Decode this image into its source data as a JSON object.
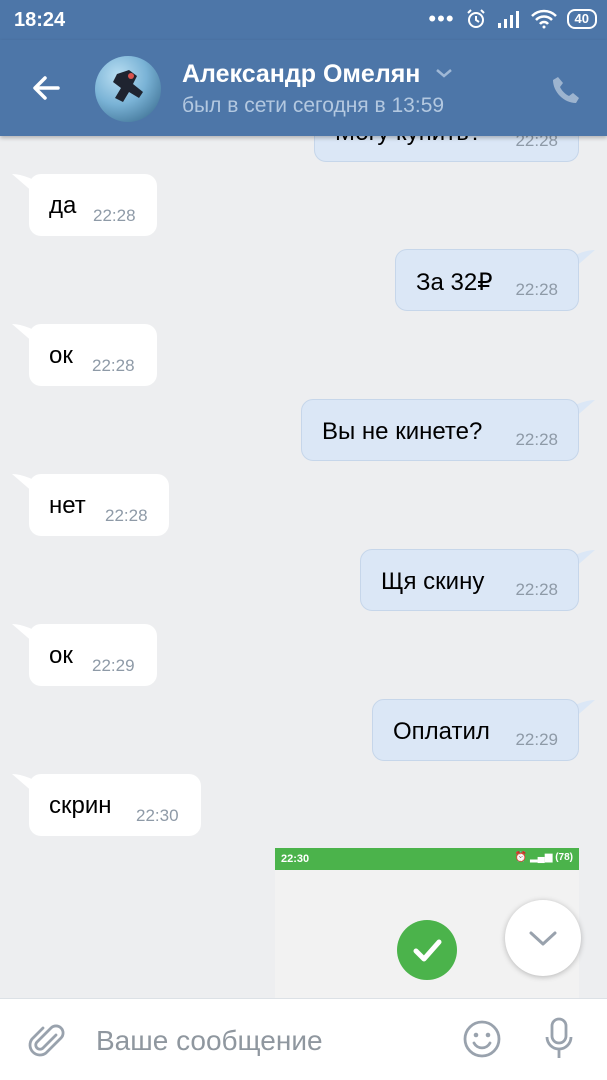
{
  "status_bar": {
    "time": "18:24",
    "dots": "•••",
    "battery": "40"
  },
  "header": {
    "contact_name": "Александр Омелян",
    "last_seen": "был в сети сегодня в 13:59"
  },
  "messages": [
    {
      "dir": "out",
      "text": "Могу купить?",
      "time": "22:28"
    },
    {
      "dir": "in",
      "text": "да",
      "time": "22:28"
    },
    {
      "dir": "out",
      "text": "За 32₽",
      "time": "22:28"
    },
    {
      "dir": "in",
      "text": "ок",
      "time": "22:28"
    },
    {
      "dir": "out",
      "text": "Вы не кинете?",
      "time": "22:28"
    },
    {
      "dir": "in",
      "text": "нет",
      "time": "22:28"
    },
    {
      "dir": "out",
      "text": "Щя скину",
      "time": "22:28"
    },
    {
      "dir": "in",
      "text": "ок",
      "time": "22:29"
    },
    {
      "dir": "out",
      "text": "Оплатил",
      "time": "22:29"
    },
    {
      "dir": "in",
      "text": "скрин",
      "time": "22:30"
    }
  ],
  "attachment": {
    "status_time": "22:30",
    "status_icons": "⏰ ▂▄▆ (78)"
  },
  "composer": {
    "placeholder": "Ваше сообщение"
  },
  "colors": {
    "header": "#4d76a8",
    "background": "#edeef0",
    "incoming_bubble": "#ffffff",
    "outgoing_bubble": "#dbe7f6",
    "success_green": "#4bb34b"
  }
}
